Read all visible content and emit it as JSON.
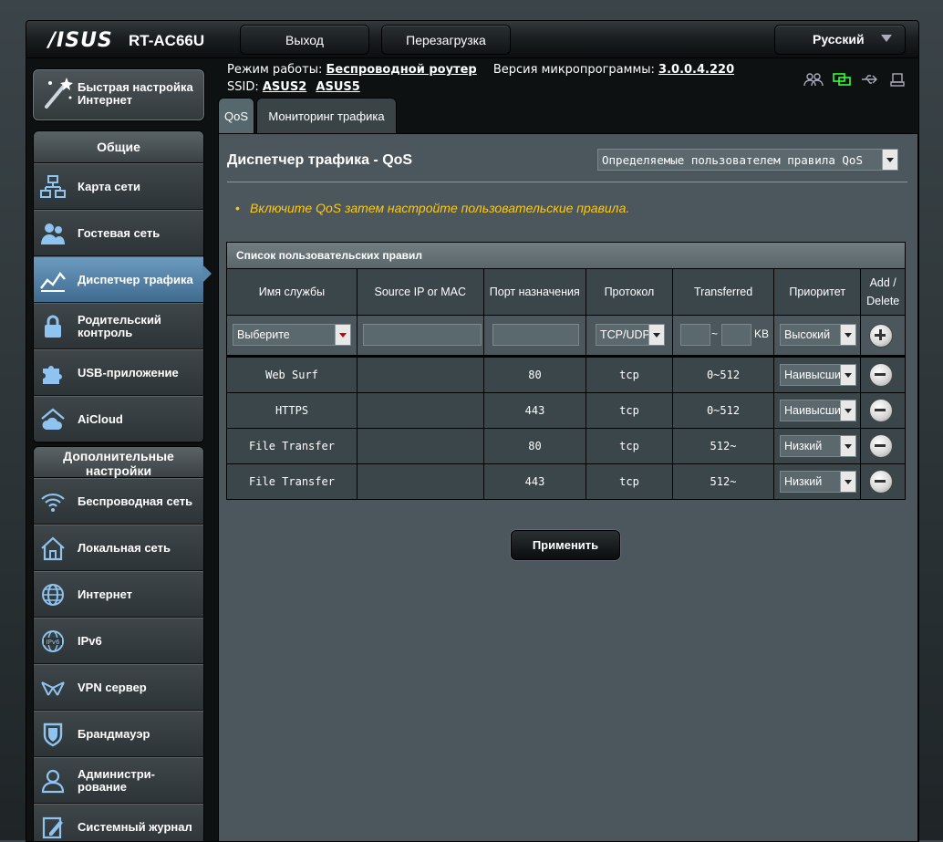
{
  "header": {
    "logo": "/ISUS",
    "model": "RT-AC66U",
    "logout_label": "Выход",
    "reboot_label": "Перезагрузка",
    "language": "Русский"
  },
  "info": {
    "mode_label": "Режим работы:",
    "mode_value": "Беспроводной роутер",
    "firmware_label": "Версия микропрограммы:",
    "firmware_value": "3.0.0.4.220",
    "ssid_label": "SSID:",
    "ssid1": "ASUS2",
    "ssid2": "ASUS5"
  },
  "sidebar": {
    "quick_setup": "Быстрая настройка Интернет",
    "general_title": "Общие",
    "general_items": [
      {
        "label": "Карта сети",
        "icon": "network-map-icon"
      },
      {
        "label": "Гостевая сеть",
        "icon": "guest-network-icon"
      },
      {
        "label": "Диспетчер трафика",
        "icon": "traffic-manager-icon"
      },
      {
        "label": "Родительский контроль",
        "icon": "lock-icon"
      },
      {
        "label": "USB-приложение",
        "icon": "puzzle-icon"
      },
      {
        "label": "AiCloud",
        "icon": "cloud-home-icon"
      }
    ],
    "advanced_title": "Дополнительные настройки",
    "advanced_items": [
      {
        "label": "Беспроводная сеть",
        "icon": "wifi-icon"
      },
      {
        "label": "Локальная сеть",
        "icon": "home-icon"
      },
      {
        "label": "Интернет",
        "icon": "globe-icon"
      },
      {
        "label": "IPv6",
        "icon": "ipv6-icon"
      },
      {
        "label": "VPN сервер",
        "icon": "vpn-icon"
      },
      {
        "label": "Брандмауэр",
        "icon": "shield-icon"
      },
      {
        "label": "Администри-рование",
        "icon": "user-icon"
      },
      {
        "label": "Системный журнал",
        "icon": "log-icon"
      }
    ]
  },
  "tabs": {
    "qos": "QoS",
    "monitor": "Мониторинг трафика"
  },
  "main": {
    "title": "Диспетчер трафика - QoS",
    "rules_dropdown": "Определяемые пользователем правила QoS",
    "notice": "Включите QoS затем настройте пользовательские правила.",
    "table_title": "Список пользовательских правил",
    "columns": {
      "service": "Имя службы",
      "source": "Source IP or MAC",
      "port": "Порт назначения",
      "protocol": "Протокол",
      "transferred": "Transferred",
      "priority": "Приоритет",
      "add_delete": "Add / Delete"
    },
    "input_row": {
      "service_select": "Выберите",
      "protocol_select": "TCP/UDP",
      "range_sep": "~",
      "kb_label": "KB",
      "priority_select": "Высокий"
    },
    "rules": [
      {
        "service": "Web Surf",
        "source": "",
        "port": "80",
        "protocol": "tcp",
        "transferred": "0~512",
        "priority": "Наивысший"
      },
      {
        "service": "HTTPS",
        "source": "",
        "port": "443",
        "protocol": "tcp",
        "transferred": "0~512",
        "priority": "Наивысший"
      },
      {
        "service": "File Transfer",
        "source": "",
        "port": "80",
        "protocol": "tcp",
        "transferred": "512~",
        "priority": "Низкий"
      },
      {
        "service": "File Transfer",
        "source": "",
        "port": "443",
        "protocol": "tcp",
        "transferred": "512~",
        "priority": "Низкий"
      }
    ],
    "apply_label": "Применить"
  }
}
